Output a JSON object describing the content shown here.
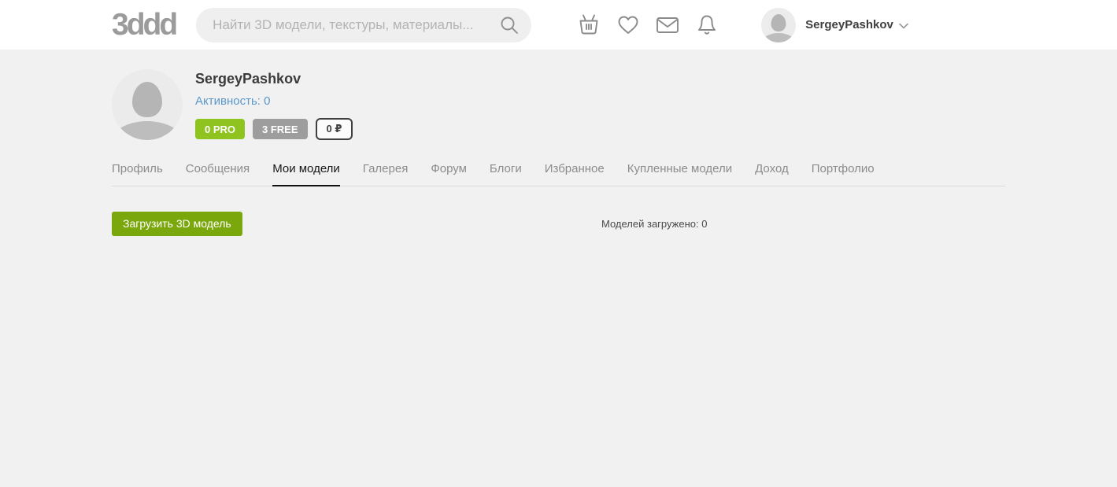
{
  "header": {
    "logo": "3ddd",
    "search_placeholder": "Найти 3D модели, текстуры, материалы...",
    "username": "SergeyPashkov",
    "icon_names": [
      "basket-icon",
      "heart-icon",
      "mail-icon",
      "bell-icon",
      "search-icon",
      "chevron-down-icon"
    ]
  },
  "profile": {
    "name": "SergeyPashkov",
    "activity": "Активность: 0",
    "badges": [
      {
        "label": "0 PRO",
        "type": "pro"
      },
      {
        "label": "3 FREE",
        "type": "free"
      },
      {
        "label": "0 ₽",
        "type": "balance"
      }
    ]
  },
  "tabs": [
    {
      "label": "Профиль",
      "active": false
    },
    {
      "label": "Сообщения",
      "active": false
    },
    {
      "label": "Мои модели",
      "active": true
    },
    {
      "label": "Галерея",
      "active": false
    },
    {
      "label": "Форум",
      "active": false
    },
    {
      "label": "Блоги",
      "active": false
    },
    {
      "label": "Избранное",
      "active": false
    },
    {
      "label": "Купленные модели",
      "active": false
    },
    {
      "label": "Доход",
      "active": false
    },
    {
      "label": "Портфолио",
      "active": false
    }
  ],
  "content": {
    "upload_button": "Загрузить 3D модель",
    "models_count": "Моделей загружено: 0"
  },
  "colors": {
    "header_bg": "#ffffff",
    "page_bg": "#f1f1f1",
    "accent_green_button": "#7aa70c",
    "badge_pro_green": "#8fc31f",
    "badge_free_gray": "#9d9d9d",
    "activity_blue": "#5b97cb",
    "tab_inactive": "#8c8c8c",
    "tab_active": "#171717"
  }
}
